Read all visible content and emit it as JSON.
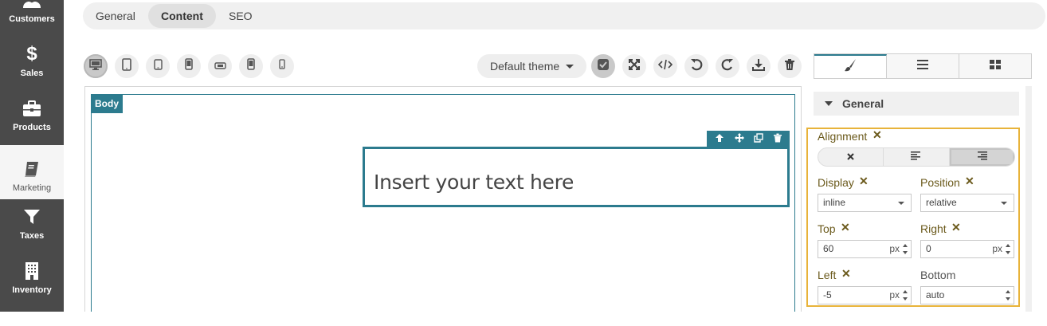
{
  "sidebar": {
    "items": [
      {
        "label": "Customers",
        "icon": "users-icon"
      },
      {
        "label": "Sales",
        "icon": "dollar-icon"
      },
      {
        "label": "Products",
        "icon": "briefcase-icon"
      },
      {
        "label": "Marketing",
        "icon": "book-icon"
      },
      {
        "label": "Taxes",
        "icon": "filter-icon"
      },
      {
        "label": "Inventory",
        "icon": "building-icon"
      }
    ],
    "active": "Marketing"
  },
  "tabs": {
    "general": "General",
    "content": "Content",
    "seo": "SEO",
    "active": "Content"
  },
  "devices": [
    "desktop-icon",
    "tablet-icon",
    "tablet-small-icon",
    "mobile-icon",
    "mobile-landscape-icon",
    "mobile-portrait-icon",
    "mobile-small-icon"
  ],
  "editor": {
    "theme_label": "Default theme",
    "body_tag": "Body",
    "text_placeholder": "Insert your text here"
  },
  "style_panel": {
    "section_title": "General",
    "alignment_label": "Alignment",
    "display_label": "Display",
    "display_value": "inline",
    "position_label": "Position",
    "position_value": "relative",
    "top_label": "Top",
    "top_value": "60",
    "top_unit": "px",
    "right_label": "Right",
    "right_value": "0",
    "right_unit": "px",
    "left_label": "Left",
    "left_value": "-5",
    "left_unit": "px",
    "bottom_label": "Bottom",
    "bottom_value": "auto",
    "clear_mark": "✕"
  },
  "colors": {
    "accent": "#2c7b8e",
    "highlight": "#e8b33a",
    "sidebar_bg": "#4a4a4a"
  }
}
